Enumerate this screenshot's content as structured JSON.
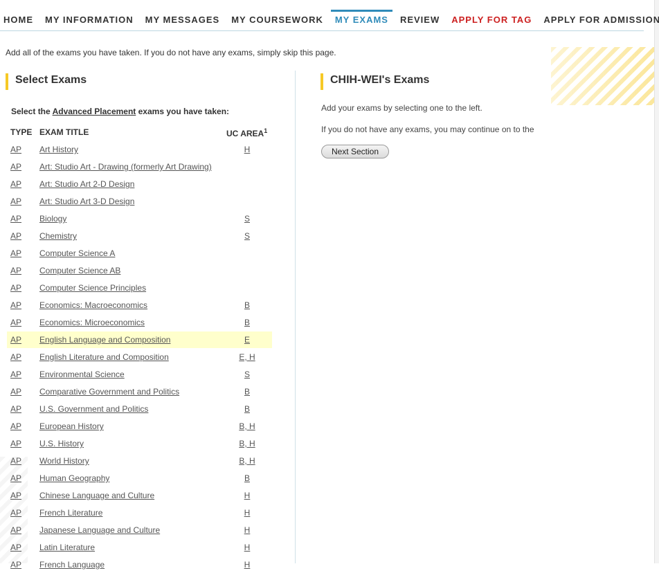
{
  "nav": {
    "items": [
      {
        "label": "HOME"
      },
      {
        "label": "MY INFORMATION"
      },
      {
        "label": "MY MESSAGES"
      },
      {
        "label": "MY COURSEWORK"
      },
      {
        "label": "MY EXAMS",
        "active": true
      },
      {
        "label": "REVIEW"
      },
      {
        "label": "APPLY FOR TAG",
        "color": "#cc1f1f"
      },
      {
        "label": "APPLY FOR ADMISSION"
      }
    ],
    "active_color": "#2f8bb9"
  },
  "intro_text": "Add all of the exams you have taken. If you do not have any exams, simply skip this page.",
  "left": {
    "title": "Select Exams",
    "select_prefix": "Select the ",
    "select_link": "Advanced Placement",
    "select_suffix": " exams you have taken:",
    "columns": {
      "type": "TYPE",
      "title": "EXAM TITLE",
      "area": "UC AREA",
      "area_note": "1"
    },
    "exams": [
      {
        "type": "AP",
        "title": "Art History",
        "area": "H"
      },
      {
        "type": "AP",
        "title": "Art: Studio Art - Drawing (formerly Art Drawing)",
        "area": ""
      },
      {
        "type": "AP",
        "title": "Art: Studio Art 2-D Design",
        "area": ""
      },
      {
        "type": "AP",
        "title": "Art: Studio Art 3-D Design",
        "area": ""
      },
      {
        "type": "AP",
        "title": "Biology",
        "area": "S"
      },
      {
        "type": "AP",
        "title": "Chemistry",
        "area": "S"
      },
      {
        "type": "AP",
        "title": "Computer Science A",
        "area": ""
      },
      {
        "type": "AP",
        "title": "Computer Science AB",
        "area": ""
      },
      {
        "type": "AP",
        "title": "Computer Science Principles",
        "area": ""
      },
      {
        "type": "AP",
        "title": "Economics: Macroeconomics",
        "area": "B"
      },
      {
        "type": "AP",
        "title": "Economics: Microeconomics",
        "area": "B"
      },
      {
        "type": "AP",
        "title": "English Language and Composition",
        "area": "E",
        "highlighted": true
      },
      {
        "type": "AP",
        "title": "English Literature and Composition",
        "area": "E, H"
      },
      {
        "type": "AP",
        "title": "Environmental Science",
        "area": "S"
      },
      {
        "type": "AP",
        "title": "Comparative Government and Politics",
        "area": "B"
      },
      {
        "type": "AP",
        "title": "U.S. Government and Politics",
        "area": "B"
      },
      {
        "type": "AP",
        "title": "European History",
        "area": "B, H"
      },
      {
        "type": "AP",
        "title": "U.S. History",
        "area": "B, H"
      },
      {
        "type": "AP",
        "title": "World History",
        "area": "B, H"
      },
      {
        "type": "AP",
        "title": "Human Geography",
        "area": "B"
      },
      {
        "type": "AP",
        "title": "Chinese Language and Culture",
        "area": "H"
      },
      {
        "type": "AP",
        "title": "French Literature",
        "area": "H"
      },
      {
        "type": "AP",
        "title": "Japanese Language and Culture",
        "area": "H"
      },
      {
        "type": "AP",
        "title": "Latin Literature",
        "area": "H"
      },
      {
        "type": "AP",
        "title": "French Language",
        "area": "H"
      }
    ],
    "highlight_color": "#ffffcc"
  },
  "right": {
    "title": "CHIH-WEI's Exams",
    "add_text": "Add your exams by selecting one to the left.",
    "no_exams_text": "If you do not have any exams, you may continue on to the",
    "next_button": "Next Section"
  },
  "accent_color": "#f6c926"
}
